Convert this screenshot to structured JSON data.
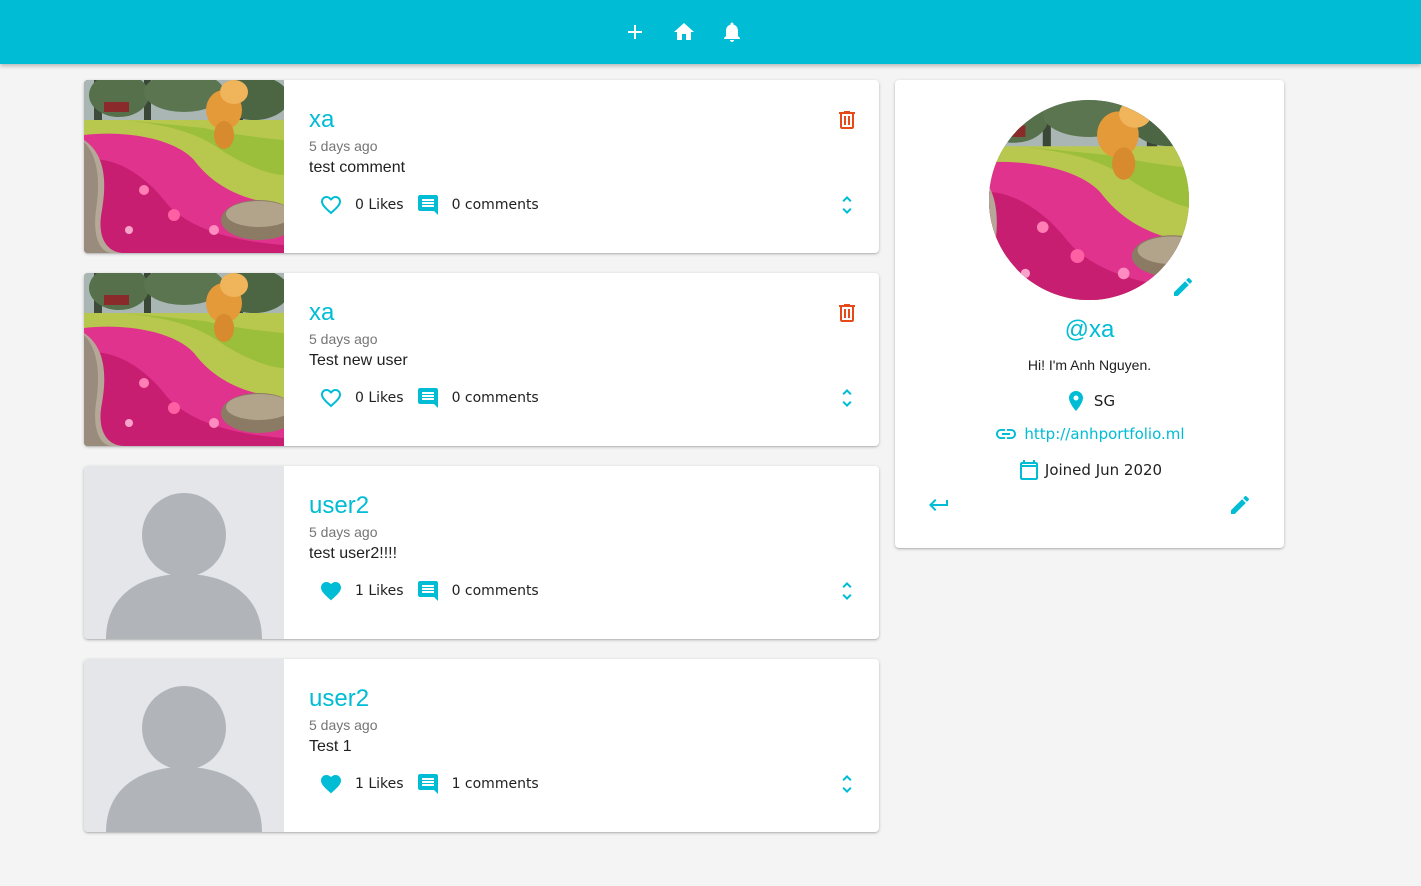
{
  "nav": {
    "add_icon": "plus-icon",
    "home_icon": "home-icon",
    "notifications_icon": "bell-icon"
  },
  "colors": {
    "primary": "#00bcd4",
    "delete": "#e64a19",
    "background": "#f4f4f4"
  },
  "posts": [
    {
      "user": "xa",
      "time": "5 days ago",
      "body": "test comment",
      "likes": "0 Likes",
      "comments": "0 comments",
      "liked": false,
      "has_image": true,
      "can_delete": true
    },
    {
      "user": "xa",
      "time": "5 days ago",
      "body": "Test new user",
      "likes": "0 Likes",
      "comments": "0 comments",
      "liked": false,
      "has_image": true,
      "can_delete": true
    },
    {
      "user": "user2",
      "time": "5 days ago",
      "body": "test user2!!!!",
      "likes": "1 Likes",
      "comments": "0 comments",
      "liked": true,
      "has_image": false,
      "can_delete": false
    },
    {
      "user": "user2",
      "time": "5 days ago",
      "body": "Test 1",
      "likes": "1 Likes",
      "comments": "1 comments",
      "liked": true,
      "has_image": false,
      "can_delete": false
    }
  ],
  "profile": {
    "handle": "@xa",
    "bio": "Hi! I'm Anh Nguyen.",
    "location": "SG",
    "website": "http://anhportfolio.ml",
    "joined": "Joined Jun 2020"
  }
}
